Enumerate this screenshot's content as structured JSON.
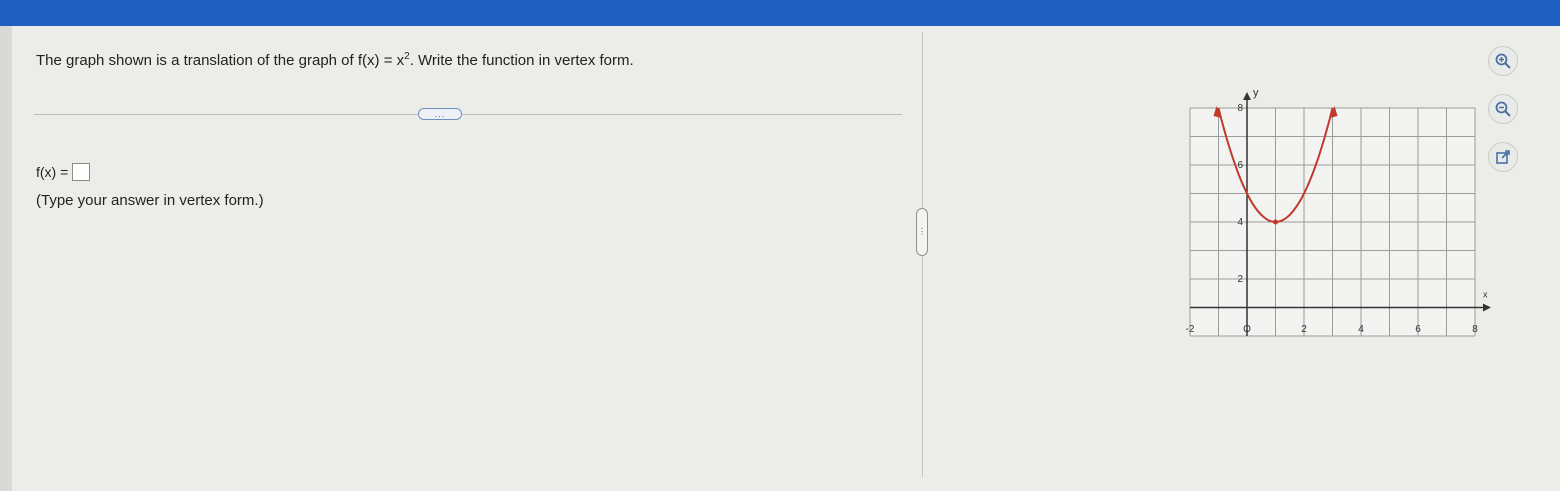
{
  "question": {
    "prefix": "The graph shown is a translation of the graph of ",
    "func": "f(x) = x",
    "exponent": "2",
    "suffix": ". Write the function in vertex form."
  },
  "more_button": "...",
  "answer": {
    "label": "f(x) =",
    "value": ""
  },
  "hint": "(Type your answer in vertex form.)",
  "divider_handle": "⋮",
  "graph": {
    "y_axis_label": "y",
    "x_axis_label": "x",
    "y_ticks": [
      "8",
      "6",
      "4",
      "2"
    ],
    "x_ticks": [
      "-2",
      "O",
      "2",
      "4",
      "6",
      "8"
    ]
  },
  "chart_data": {
    "type": "line",
    "title": "",
    "xlabel": "x",
    "ylabel": "y",
    "xlim": [
      -2,
      8
    ],
    "ylim": [
      0,
      8
    ],
    "grid": true,
    "series": [
      {
        "x": [
          -1,
          -0.5,
          0,
          0.5,
          1,
          1.5,
          2,
          2.5,
          3
        ],
        "y": [
          8,
          6.25,
          5,
          4.25,
          4,
          4.25,
          5,
          6.25,
          8
        ],
        "color": "#c0392b"
      }
    ],
    "vertex": [
      1,
      4
    ]
  },
  "tools": [
    "zoom-in-icon",
    "zoom-out-icon",
    "popout-icon"
  ]
}
